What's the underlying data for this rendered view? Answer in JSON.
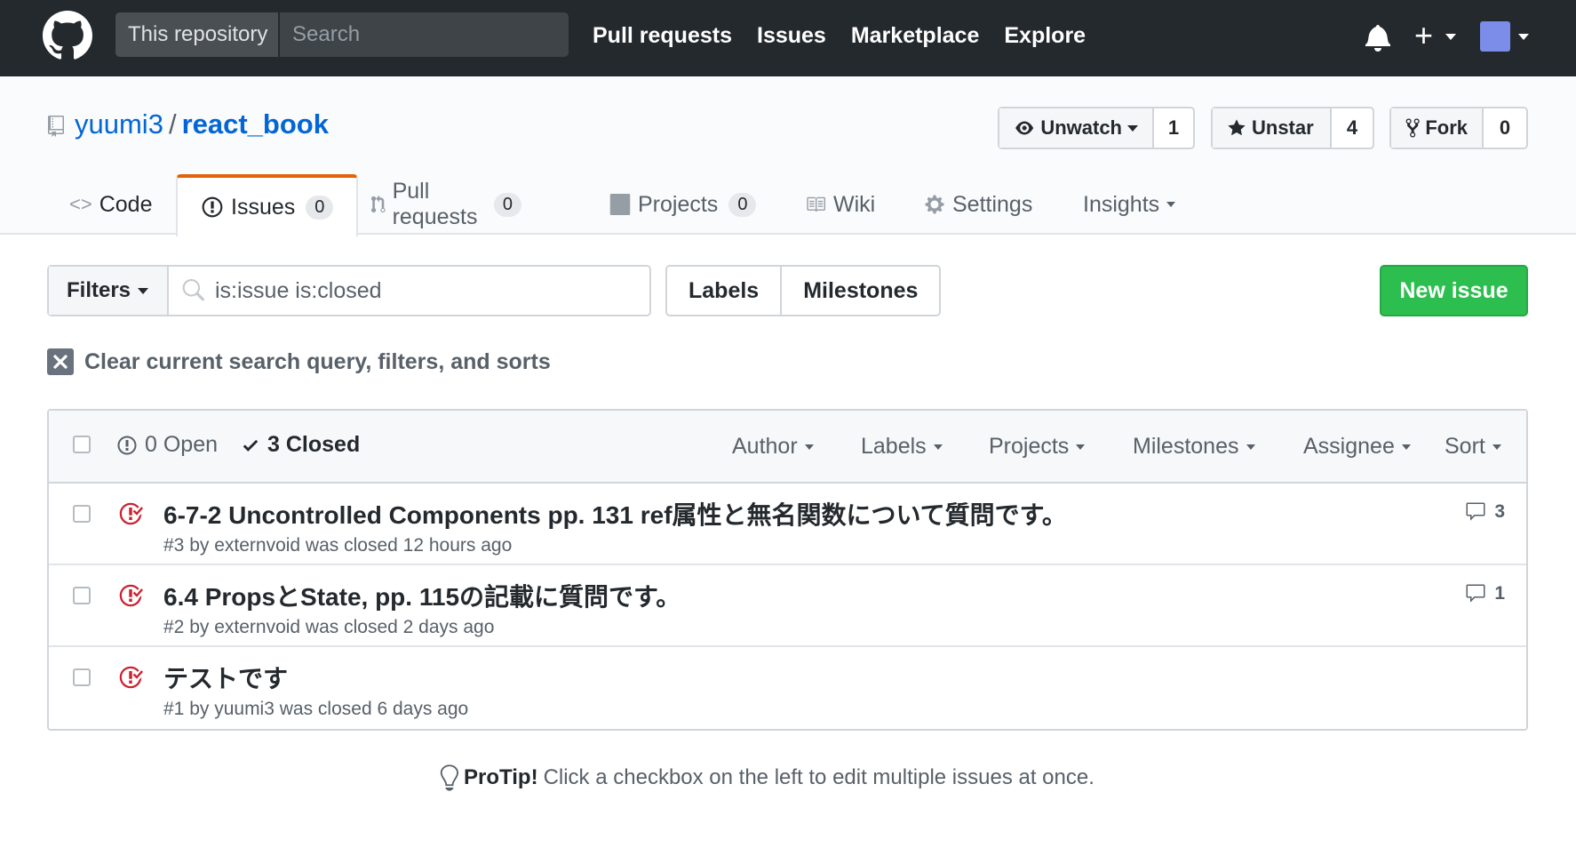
{
  "header": {
    "search_scope": "This repository",
    "search_placeholder": "Search",
    "nav": [
      "Pull requests",
      "Issues",
      "Marketplace",
      "Explore"
    ]
  },
  "repo": {
    "owner": "yuumi3",
    "separator": "/",
    "name": "react_book",
    "watch_label": "Unwatch",
    "watch_count": "1",
    "star_label": "Unstar",
    "star_count": "4",
    "fork_label": "Fork",
    "fork_count": "0"
  },
  "tabs": {
    "code": "Code",
    "issues": "Issues",
    "issues_count": "0",
    "pulls": "Pull requests",
    "pulls_count": "0",
    "projects": "Projects",
    "projects_count": "0",
    "wiki": "Wiki",
    "settings": "Settings",
    "insights": "Insights"
  },
  "subnav": {
    "filters_label": "Filters",
    "query": "is:issue is:closed",
    "labels": "Labels",
    "milestones": "Milestones",
    "new_issue": "New issue",
    "clear": "Clear current search query, filters, and sorts"
  },
  "list_header": {
    "open": "0 Open",
    "closed": "3 Closed",
    "author": "Author",
    "labels": "Labels",
    "projects": "Projects",
    "milestones": "Milestones",
    "assignee": "Assignee",
    "sort": "Sort"
  },
  "issues": [
    {
      "title": "6-7-2 Uncontrolled Components pp. 131 ref属性と無名関数について質問です。",
      "meta": "#3 by externvoid was closed 12 hours ago",
      "comments": "3"
    },
    {
      "title": "6.4 PropsとState, pp. 115の記載に質問です。",
      "meta": "#2 by externvoid was closed 2 days ago",
      "comments": "1"
    },
    {
      "title": "テストです",
      "meta": "#1 by yuumi3 was closed 6 days ago",
      "comments": ""
    }
  ],
  "protip": {
    "label": "ProTip!",
    "text": "Click a checkbox on the left to edit multiple issues at once."
  },
  "colors": {
    "header_bg": "#24292e",
    "link": "#0366d6",
    "closed_red": "#cb2431",
    "green": "#2cbe4e",
    "tab_accent": "#e36209"
  }
}
